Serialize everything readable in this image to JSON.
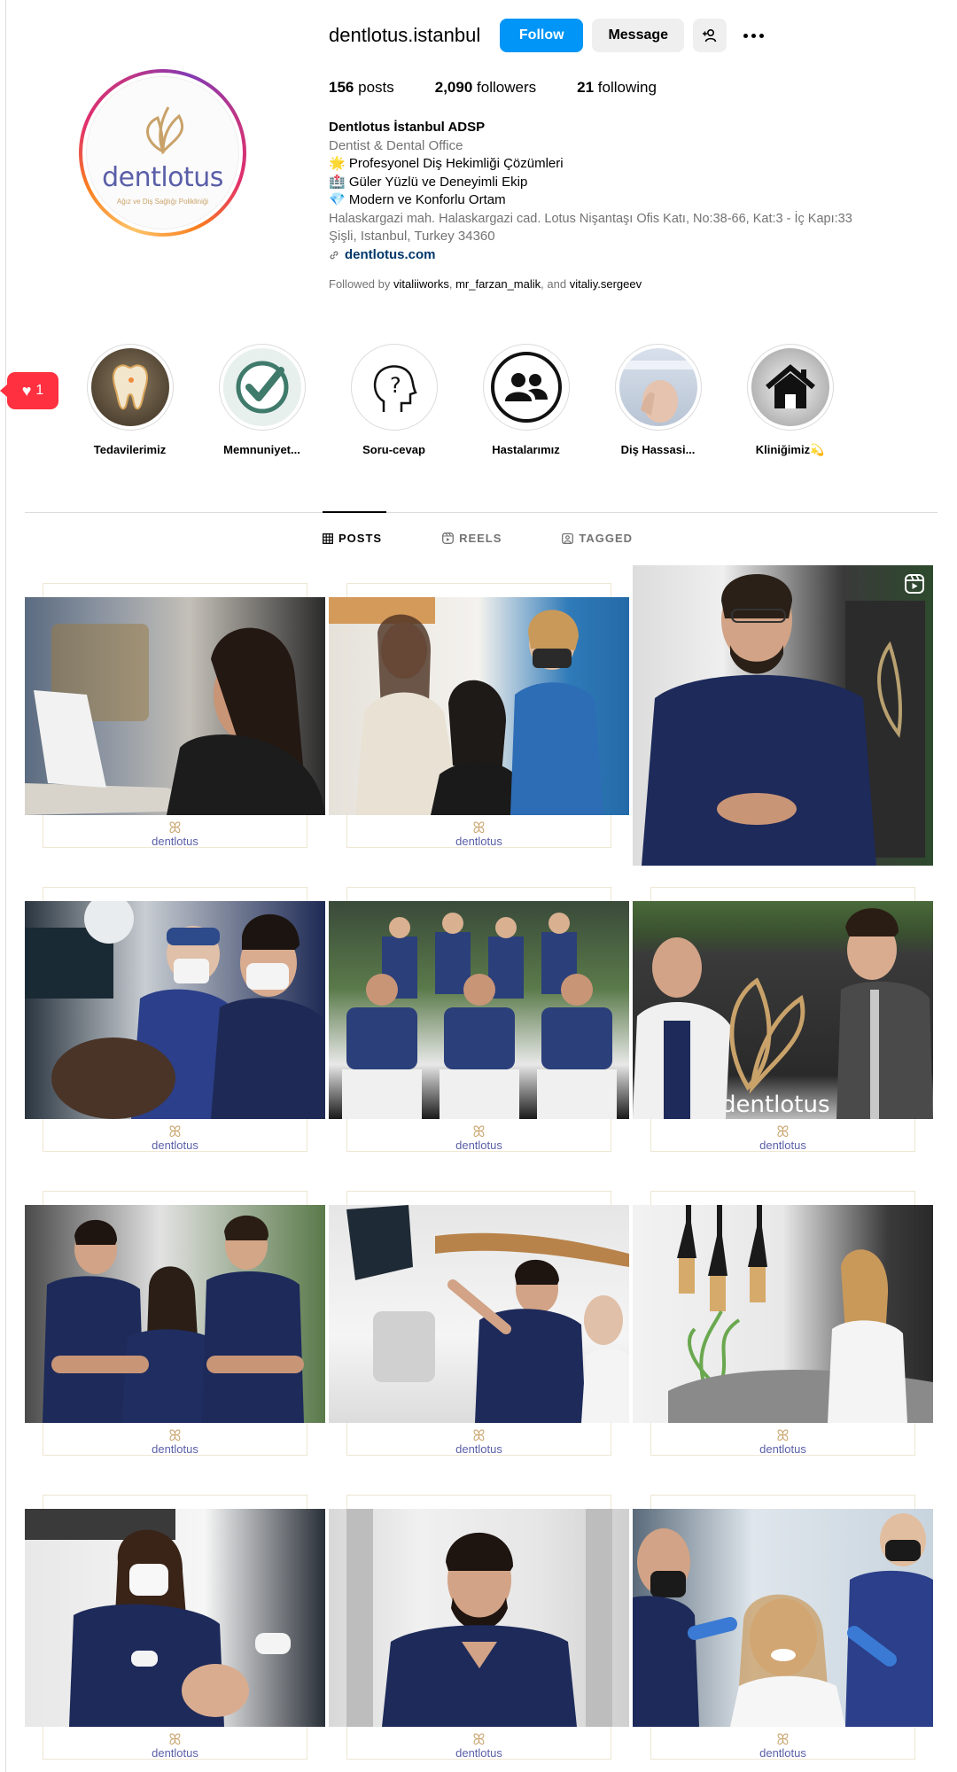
{
  "profile": {
    "username": "dentlotus.istanbul",
    "follow_label": "Follow",
    "message_label": "Message",
    "avatar_word": "dentlotus",
    "avatar_sub": "Ağız ve Diş Sağlığı Polikliniği"
  },
  "stats": {
    "posts_count": "156",
    "posts_label": "posts",
    "followers_count": "2,090",
    "followers_label": "followers",
    "following_count": "21",
    "following_label": "following"
  },
  "bio": {
    "name": "Dentlotus İstanbul ADSP",
    "category": "Dentist & Dental Office",
    "line1": "🌟 Profesyonel Diş Hekimliği Çözümleri",
    "line2": "🏥 Güler Yüzlü ve Deneyimli Ekip",
    "line3": "💎 Modern ve Konforlu Ortam",
    "address1": "Halaskargazi mah. Halaskargazi cad. Lotus Nişantaşı Ofis Katı, No:38-66, Kat:3 - İç Kapı:33",
    "address2": "Şişli, Istanbul, Turkey 34360",
    "link": "dentlotus.com"
  },
  "followed_by": {
    "prefix": "Followed by ",
    "user1": "vitaliiworks",
    "sep1": ", ",
    "user2": "mr_farzan_malik",
    "sep2": ", and ",
    "user3": "vitaliy.sergeev"
  },
  "notification": {
    "count": "1"
  },
  "highlights": [
    {
      "label": "Tedavilerimiz",
      "icon": "tooth-icon"
    },
    {
      "label": "Memnuniyet...",
      "icon": "checkmark-icon"
    },
    {
      "label": "Soru-cevap",
      "icon": "question-head-icon"
    },
    {
      "label": "Hastalarımız",
      "icon": "people-icon"
    },
    {
      "label": "Diş Hassasi...",
      "icon": "patient-photo"
    },
    {
      "label": "Kliniğimiz💫",
      "icon": "house-icon"
    }
  ],
  "tabs": {
    "posts": "POSTS",
    "reels": "REELS",
    "tagged": "TAGGED"
  },
  "post_logo_word": "dentlotus",
  "colors": {
    "follow": "#0095f6",
    "brand": "#5a5fa8",
    "gold": "#c9a26a",
    "notif": "#ff3040"
  }
}
